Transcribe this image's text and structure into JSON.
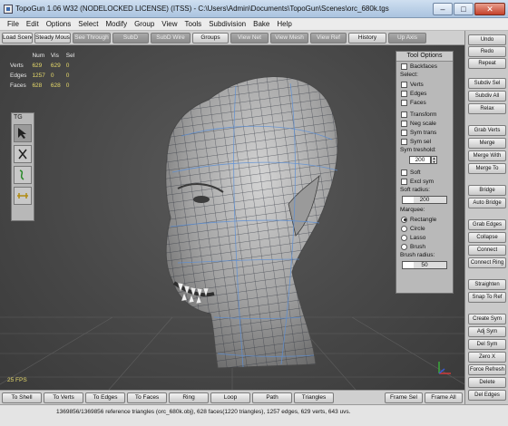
{
  "window": {
    "title": "TopoGun 1.06 W32  (NODELOCKED LICENSE) (ITSS) - C:\\Users\\Admin\\Documents\\TopoGun\\Scenes\\orc_680k.tgs",
    "minimize_glyph": "–",
    "maximize_glyph": "□",
    "close_glyph": "✕"
  },
  "menu": [
    "File",
    "Edit",
    "Options",
    "Select",
    "Modify",
    "Group",
    "View",
    "Tools",
    "Subdivision",
    "Bake",
    "Help"
  ],
  "toolbar": [
    {
      "label": "Load Scene",
      "active": false
    },
    {
      "label": "Steady Mouse",
      "active": false
    },
    {
      "label": "See Through",
      "active": true
    },
    {
      "label": "SubD",
      "active": true
    },
    {
      "label": "SubD Wire",
      "active": true
    },
    {
      "label": "Groups",
      "active": false
    },
    {
      "label": "View Net",
      "active": true
    },
    {
      "label": "View Mesh",
      "active": true
    },
    {
      "label": "View Ref",
      "active": true
    },
    {
      "label": "History",
      "active": false
    },
    {
      "label": "Up Axis",
      "active": true
    }
  ],
  "stats": {
    "headers": [
      "Num",
      "Vis",
      "Sel"
    ],
    "rows": [
      {
        "label": "Verts",
        "num": "629",
        "vis": "629",
        "sel": "0"
      },
      {
        "label": "Edges",
        "num": "1257",
        "vis": "0",
        "sel": "0"
      },
      {
        "label": "Faces",
        "num": "628",
        "vis": "628",
        "sel": "0"
      }
    ]
  },
  "tg_panel": {
    "label": "TG",
    "tools": [
      {
        "icon": "select-arrow-icon",
        "active": true
      },
      {
        "icon": "cut-scissors-icon",
        "active": false
      },
      {
        "icon": "brush-draw-icon",
        "active": false
      },
      {
        "icon": "bridge-icon",
        "active": false
      }
    ]
  },
  "tool_options": {
    "title": "Tool Options",
    "backfaces": "Backfaces",
    "select_label": "Select:",
    "select_items": [
      "Verts",
      "Edges",
      "Faces"
    ],
    "transform_items": [
      "Transform",
      "Neg scale",
      "Sym trans",
      "Sym sel"
    ],
    "sym_threshold_label": "Sym treshold:",
    "sym_threshold_value": "200",
    "soft_items": [
      "Soft",
      "Excl sym"
    ],
    "soft_radius_label": "Soft radius:",
    "soft_radius_value": "200",
    "soft_radius_level": 0.25,
    "marquee_label": "Marquee:",
    "marquee_items": [
      "Rectangle",
      "Circle",
      "Lasso",
      "Brush"
    ],
    "marquee_selected": "Rectangle",
    "brush_radius_label": "Brush radius:",
    "brush_radius_value": "50",
    "brush_radius_level": 0.25
  },
  "fps": "25 FPS",
  "right_panel": [
    "Undo",
    "Redo",
    "Repeat",
    "Subdiv Sel",
    "Subdiv All",
    "Relax",
    "Grab Verts",
    "Merge",
    "Merge With",
    "Merge To",
    "Bridge",
    "Auto Bridge",
    "Grab Edges",
    "Collapse",
    "Connect",
    "Connect Ring",
    "Straighten",
    "Snap To Ref",
    "Create Sym",
    "Adj Sym",
    "Del Sym",
    "Zero X",
    "Force Refresh",
    "Delete",
    "Del Edges"
  ],
  "bottom_left": [
    "To Shell",
    "To Verts",
    "To Edges",
    "To Faces",
    "Ring",
    "Loop",
    "Path",
    "Triangles"
  ],
  "bottom_right": [
    "Frame Sel",
    "Frame All"
  ],
  "status": "1369856/1369856 reference triangles (orc_680k.obj), 628 faces(1220 triangles), 1257 edges, 629 verts, 643 uvs.",
  "colors": {
    "viewport_bg": "#474747",
    "mesh_wire": "#5b8fd6",
    "stat_numbers": "#e6d96a"
  }
}
